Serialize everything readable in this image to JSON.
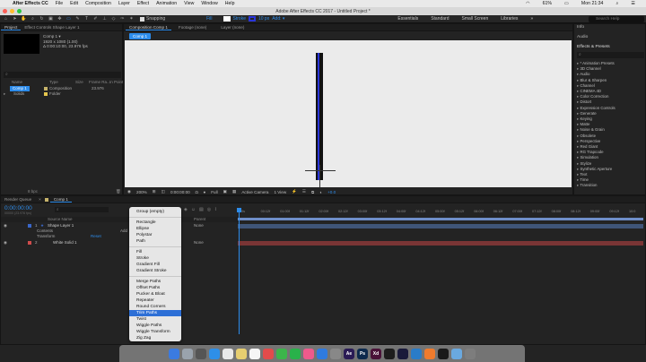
{
  "menubar": {
    "app": "After Effects CC",
    "items": [
      "File",
      "Edit",
      "Composition",
      "Layer",
      "Effect",
      "Animation",
      "View",
      "Window",
      "Help"
    ],
    "clock": "Mon 21:34",
    "battery": "61%"
  },
  "window": {
    "title": "Adobe After Effects CC 2017 - Untitled Project *"
  },
  "toolbar": {
    "snapping": "Snapping",
    "fill": "Fill",
    "stroke": "Stroke",
    "stroke_width": "10 px",
    "workspaces": [
      "Essentials",
      "Standard",
      "Small Screen",
      "Libraries"
    ],
    "search_placeholder": "Search Help"
  },
  "project": {
    "tab1": "Project",
    "tab2": "Effect Controls Shape Layer 1",
    "comp_name": "Comp 1 ▾",
    "comp_info1": "1920 x 1080 (1.00)",
    "comp_info2": "Δ 0:00:10:00, 23.976 fps",
    "columns": [
      "Name",
      "Type",
      "Size",
      "Frame Ra...",
      "In Point"
    ],
    "items": [
      {
        "name": "Comp 1",
        "type": "Composition",
        "fps": "23.976",
        "color": "#c6b36a"
      },
      {
        "name": "Solids",
        "type": "Folder",
        "fps": "",
        "color": "#e5c64e"
      }
    ],
    "bpc": "8 bpc"
  },
  "viewer": {
    "tab_comp": "Composition Comp 1",
    "tab_footage": "Footage (none)",
    "tab_layer": "Layer (none)",
    "breadcrumb": "Comp 1",
    "zoom": "200%",
    "timecode": "0:00:00:00",
    "resolution": "Full",
    "camera": "Active Camera",
    "views": "1 View",
    "exposure": "+0.0"
  },
  "right": {
    "info": "Info",
    "audio": "Audio",
    "effects_title": "Effects & Presets",
    "effects": [
      "* Animation Presets",
      "3D Channel",
      "Audio",
      "Blur & Sharpen",
      "Channel",
      "CINEMA 4D",
      "Color Correction",
      "Distort",
      "Expression Controls",
      "Generate",
      "Keying",
      "Matte",
      "Noise & Grain",
      "Obsolete",
      "Perspective",
      "Red Giant",
      "RG Trapcode",
      "Simulation",
      "Stylize",
      "Synthetic Aperture",
      "Text",
      "Time",
      "Transition"
    ]
  },
  "timeline": {
    "tab_render": "Render Queue",
    "tab_comp": "Comp 1",
    "timecode": "0:00:00:00",
    "timecode_sub": "00000 (23.976 fps)",
    "col_source": "Source Name",
    "col_parent": "Parent",
    "layers": [
      {
        "num": "1",
        "name": "Shape Layer 1",
        "parent": "None"
      },
      {
        "num": "2",
        "name": "White Solid 1",
        "parent": "None"
      }
    ],
    "sub_contents": "Contents",
    "sub_add": "Add",
    "sub_transform": "Transform",
    "reset": "Reset",
    "ruler": [
      "0s",
      "00:12f",
      "01:00f",
      "01:12f",
      "02:00f",
      "02:12f",
      "03:00f",
      "03:12f",
      "04:00f",
      "04:12f",
      "05:00f",
      "05:12f",
      "06:00f",
      "06:12f",
      "07:00f",
      "07:12f",
      "08:00f",
      "08:12f",
      "09:00f",
      "09:12f",
      "10:0"
    ]
  },
  "context_menu": {
    "group": [
      "Group (empty)"
    ],
    "shapes": [
      "Rectangle",
      "Ellipse",
      "Polystar",
      "Path"
    ],
    "styles": [
      "Fill",
      "Stroke",
      "Gradient Fill",
      "Gradient Stroke"
    ],
    "ops": [
      "Merge Paths",
      "Offset Paths",
      "Pucker & Bloat",
      "Repeater",
      "Round Corners",
      "Trim Paths",
      "Twist",
      "Wiggle Paths",
      "Wiggle Transform",
      "Zig Zag"
    ],
    "highlighted": "Trim Paths"
  },
  "dock": {
    "apps": [
      {
        "label": "",
        "color": "#3b7be0",
        "name": "finder-icon"
      },
      {
        "label": "",
        "color": "#9aa3ad",
        "name": "siri-icon"
      },
      {
        "label": "",
        "color": "#555",
        "name": "launchpad-icon"
      },
      {
        "label": "",
        "color": "#2e8fe8",
        "name": "safari-icon"
      },
      {
        "label": "",
        "color": "#e9e9e9",
        "name": "chrome-icon"
      },
      {
        "label": "",
        "color": "#e6ce70",
        "name": "notes-icon"
      },
      {
        "label": "",
        "color": "#f5f5f5",
        "name": "calendar-icon"
      },
      {
        "label": "",
        "color": "#e24b4b",
        "name": "photos-icon"
      },
      {
        "label": "",
        "color": "#3cb54b",
        "name": "messages-icon"
      },
      {
        "label": "",
        "color": "#29b24a",
        "name": "facetime-icon"
      },
      {
        "label": "",
        "color": "#ef5a8c",
        "name": "itunes-icon"
      },
      {
        "label": "",
        "color": "#2f7be0",
        "name": "appstore-icon"
      },
      {
        "label": "",
        "color": "#888",
        "name": "preferences-icon"
      },
      {
        "label": "Ae",
        "color": "#2a1b55",
        "name": "after-effects-icon"
      },
      {
        "label": "Ps",
        "color": "#0d2a4d",
        "name": "photoshop-icon"
      },
      {
        "label": "Xd",
        "color": "#4a1238",
        "name": "xd-icon"
      },
      {
        "label": "",
        "color": "#1d1d1d",
        "name": "dreamweaver-icon"
      },
      {
        "label": "",
        "color": "#1a1a3a",
        "name": "premiere-icon"
      },
      {
        "label": "",
        "color": "#2a7cc8",
        "name": "word-icon"
      },
      {
        "label": "",
        "color": "#ef7b2d",
        "name": "powerpoint-icon"
      },
      {
        "label": "",
        "color": "#1a1a1a",
        "name": "terminal-icon"
      },
      {
        "label": "",
        "color": "#6aa9e0",
        "name": "folder-icon"
      },
      {
        "label": "",
        "color": "#7d7d7d",
        "name": "trash-icon"
      }
    ]
  }
}
